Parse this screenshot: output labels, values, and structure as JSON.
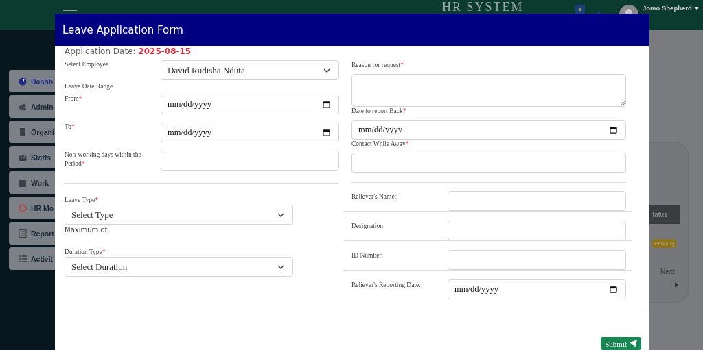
{
  "background": {
    "app_title": "HR SYSTEM",
    "user_name": "Jomo Shepherd",
    "sidebar": {
      "items": [
        {
          "label": "Dashb",
          "selected": true
        },
        {
          "label": "Admin",
          "selected": false
        },
        {
          "label": "Organi",
          "selected": false
        },
        {
          "label": "Staffs",
          "selected": false
        },
        {
          "label": "Work",
          "selected": false
        },
        {
          "label": "HR Mo",
          "selected": false
        },
        {
          "label": "Report",
          "selected": false
        },
        {
          "label": "Activit",
          "selected": false
        }
      ]
    },
    "table": {
      "column_header": "tatus",
      "badge": "Pending",
      "pager_next": "Next"
    }
  },
  "modal": {
    "title": "Leave Application Form",
    "application_date_label": "Application Date:",
    "application_date": "2025-08-15",
    "left_fields": [
      {
        "kind": "select",
        "label": "Select Employee",
        "value": "David Rudisha Nduta"
      },
      {
        "kind": "heading",
        "label": "Leave Date Range"
      },
      {
        "kind": "date",
        "label": "From",
        "required_mark": "*",
        "placeholder": "mm/dd/yyyy"
      },
      {
        "kind": "date",
        "label": "To",
        "required_mark": "*",
        "placeholder": "mm/dd/yyyy"
      },
      {
        "kind": "text",
        "label": "Non-working days within the Period",
        "required_mark": "*"
      }
    ],
    "leave_type": {
      "label": "Leave Type",
      "required_mark": "*",
      "value": "Select Type",
      "note": "Maximum of:"
    },
    "duration_type": {
      "label": "Duration Type",
      "required_mark": "*",
      "value": "Select Duration"
    },
    "right_fields": [
      {
        "kind": "textarea",
        "label": "Reason for request",
        "required_mark": "*"
      },
      {
        "kind": "date",
        "label": "Date to report Back",
        "required_mark": "*",
        "placeholder": "mm/dd/yyyy"
      },
      {
        "kind": "text",
        "label": "Contact While Away",
        "required_mark": "*"
      }
    ],
    "reliever_fields": [
      {
        "kind": "text",
        "label": "Reliever's Name:"
      },
      {
        "kind": "text",
        "label": "Designation:"
      },
      {
        "kind": "text",
        "label": "ID Number:"
      },
      {
        "kind": "date",
        "label": "Reliever's Reporting Date:",
        "placeholder": "mm/dd/yyyy"
      }
    ],
    "submit_label": "Submit"
  }
}
